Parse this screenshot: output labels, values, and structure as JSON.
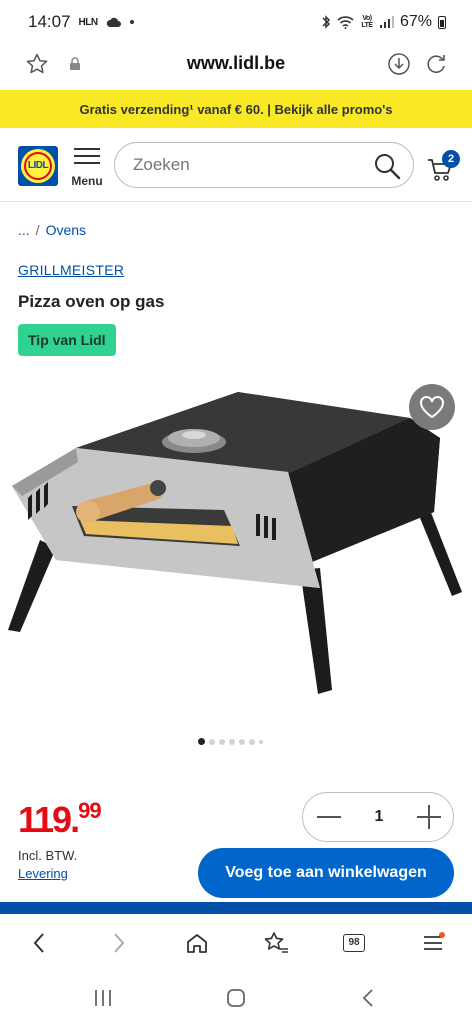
{
  "status_bar": {
    "time": "14:07",
    "carrier_tag": "HLN",
    "network_tag": "Vo) LTE",
    "battery": "67%"
  },
  "browser": {
    "url": "www.lidl.be"
  },
  "promo_banner": {
    "text": "Gratis verzending¹ vanaf € 60. | Bekijk alle promo's"
  },
  "header": {
    "logo_text": "LIDL",
    "menu_label": "Menu",
    "search_placeholder": "Zoeken",
    "cart_count": "2"
  },
  "breadcrumb": {
    "ellipsis": "...",
    "separator": "/",
    "current": "Ovens"
  },
  "product": {
    "brand": "GRILLMEISTER",
    "title": "Pizza oven op gas",
    "badge": "Tip van Lidl",
    "image_count": 7,
    "active_image": 1
  },
  "purchase": {
    "price_main": "119.",
    "price_cents": "99",
    "vat_note": "Incl. BTW.",
    "delivery_link": "Levering",
    "quantity": "1",
    "add_to_cart": "Voeg toe aan winkelwagen"
  },
  "browser_nav": {
    "tabs_count": "98"
  },
  "colors": {
    "lidl_blue": "#0050aa",
    "promo_yellow": "#f8e825",
    "price_red": "#e60a14",
    "badge_green": "#2fd28f",
    "button_blue": "#0066cc"
  }
}
